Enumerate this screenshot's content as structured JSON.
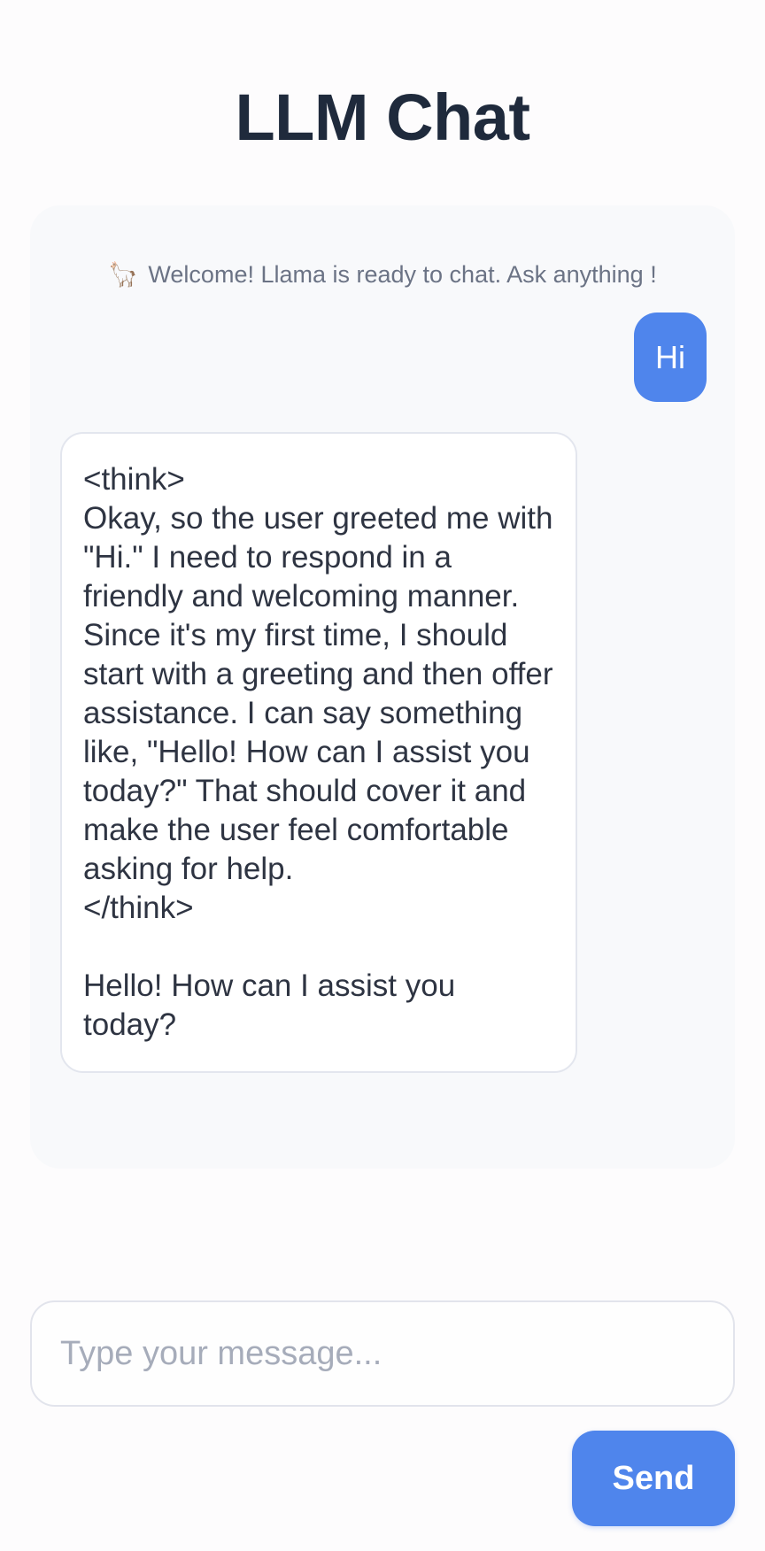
{
  "header": {
    "title": "LLM Chat"
  },
  "chat": {
    "welcome_icon": "🦙",
    "welcome_text": "Welcome! Llama is ready to chat. Ask anything !",
    "messages": [
      {
        "role": "user",
        "text": "Hi"
      },
      {
        "role": "assistant",
        "text": "<think>\nOkay, so the user greeted me with \"Hi.\" I need to respond in a friendly and welcoming manner. Since it's my first time, I should start with a greeting and then offer assistance. I can say something like, \"Hello! How can I assist you today?\" That should cover it and make the user feel comfortable asking for help.\n</think>\n\nHello! How can I assist you today?"
      }
    ]
  },
  "composer": {
    "value": "",
    "placeholder": "Type your message...",
    "send_label": "Send"
  },
  "colors": {
    "accent": "#4f85ec",
    "title": "#1f2a3c",
    "panel_bg": "#f8f9fb",
    "muted_text": "#6b7385"
  }
}
